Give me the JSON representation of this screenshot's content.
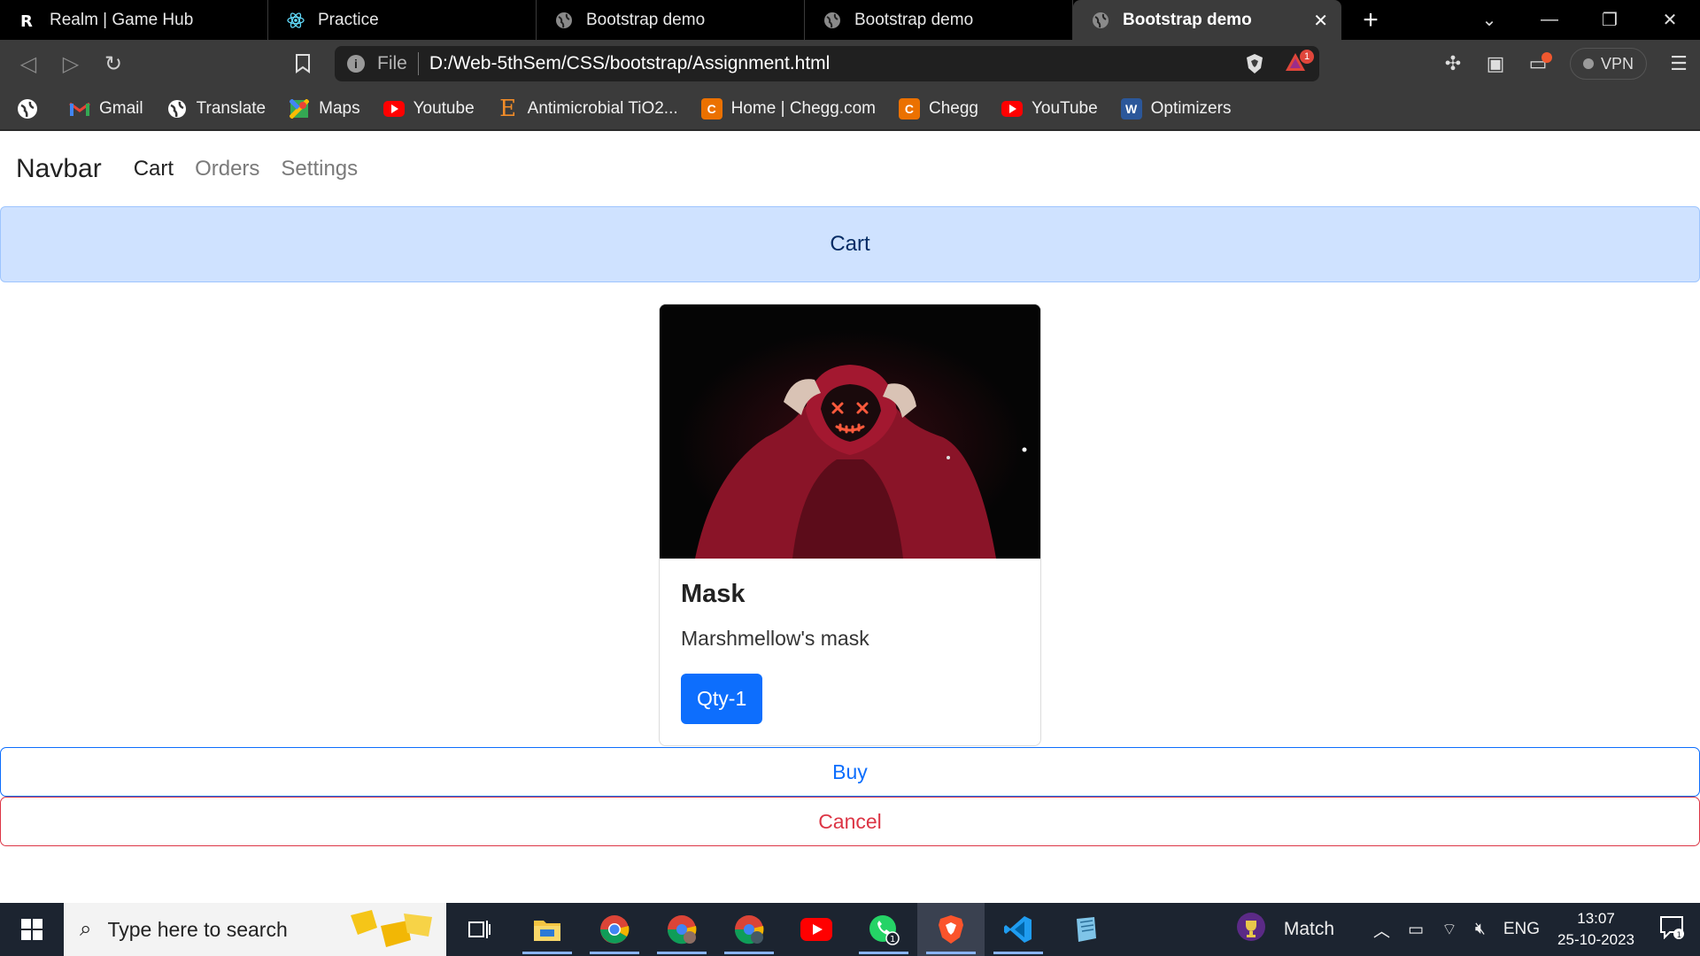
{
  "browser": {
    "tabs": [
      {
        "label": "Realm | Game Hub",
        "icon": "realm-logo-icon"
      },
      {
        "label": "Practice",
        "icon": "react-logo-icon"
      },
      {
        "label": "Bootstrap demo",
        "icon": "globe-icon"
      },
      {
        "label": "Bootstrap demo",
        "icon": "globe-icon"
      },
      {
        "label": "Bootstrap demo",
        "icon": "globe-icon",
        "active": true
      }
    ],
    "url_scheme": "File",
    "url": "D:/Web-5thSem/CSS/bootstrap/Assignment.html",
    "alert_badge": "1",
    "vpn_label": "VPN",
    "bookmarks": [
      {
        "label": "",
        "icon": "globe-icon"
      },
      {
        "label": "Gmail",
        "icon": "gmail-icon"
      },
      {
        "label": "Translate",
        "icon": "globe-icon"
      },
      {
        "label": "Maps",
        "icon": "maps-icon"
      },
      {
        "label": "Youtube",
        "icon": "youtube-icon"
      },
      {
        "label": "Antimicrobial TiO2...",
        "icon": "elsevier-icon"
      },
      {
        "label": "Home | Chegg.com",
        "icon": "chegg-icon"
      },
      {
        "label": "Chegg",
        "icon": "chegg-icon"
      },
      {
        "label": "YouTube",
        "icon": "youtube-icon"
      },
      {
        "label": "Optimizers",
        "icon": "word-icon"
      }
    ]
  },
  "site": {
    "brand": "Navbar",
    "nav": [
      "Cart",
      "Orders",
      "Settings"
    ],
    "banner": "Cart",
    "card": {
      "title": "Mask",
      "text": "Marshmellow's mask",
      "button": "Qty-1"
    },
    "buy": "Buy",
    "cancel": "Cancel"
  },
  "colors": {
    "primary": "#0d6efd",
    "danger": "#dc3545",
    "banner_bg": "#cfe2ff",
    "chrome_dark": "#3b3b3b"
  },
  "taskbar": {
    "search_placeholder": "Type here to search",
    "weather_label": "Match",
    "language": "ENG",
    "time": "13:07",
    "date": "25-10-2023",
    "notification_count": "1",
    "whatsapp_badge": "1"
  }
}
